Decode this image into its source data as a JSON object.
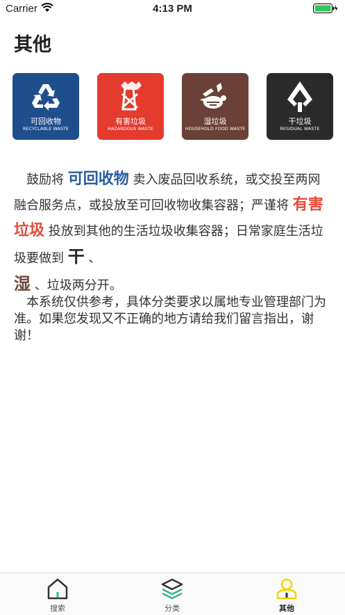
{
  "status_bar": {
    "carrier": "Carrier",
    "time": "4:13 PM"
  },
  "page": {
    "title": "其他"
  },
  "categories": [
    {
      "cn": "可回收物",
      "en": "RECYCLABLE WASTE",
      "color": "#1f4e8c",
      "icon": "recycle-icon"
    },
    {
      "cn": "有害垃圾",
      "en": "HAZARDOUS WASTE",
      "color": "#e53a2e",
      "icon": "hazardous-icon"
    },
    {
      "cn": "湿垃圾",
      "en": "HOUSEHOLD FOOD WASTE",
      "color": "#6b4036",
      "icon": "food-waste-icon"
    },
    {
      "cn": "干垃圾",
      "en": "RESIDUAL WASTE",
      "color": "#2b2b2b",
      "icon": "residual-waste-icon"
    }
  ],
  "description": {
    "p1": {
      "t1": "鼓励将",
      "recyclable": "可回收物",
      "t2": "卖入废品回收系统，或交投至两网融合服务点，或投放至可回收物收集容器；严谨将",
      "hazardous": "有害垃圾",
      "t3": "投放到其他的生活垃圾收集容器；日常家庭生活垃圾要做到",
      "dry": "干",
      "t4": "、",
      "wet": "湿",
      "t5": "、垃圾两分开。"
    },
    "p2": "本系统仅供参考，具体分类要求以属地专业管理部门为准。如果您发现又不正确的地方请给我们留言指出，谢谢！"
  },
  "tabs": [
    {
      "label": "搜索",
      "icon": "home-icon",
      "active": false
    },
    {
      "label": "分类",
      "icon": "layers-icon",
      "active": false
    },
    {
      "label": "其他",
      "icon": "user-icon",
      "active": true
    }
  ],
  "colors": {
    "accent_blue": "#2a5aa0",
    "accent_red": "#e34b3a",
    "accent_brown": "#6b4a3e",
    "tab_active": "#f5d400",
    "tab_green": "#2eb886",
    "battery_green": "#34c759"
  }
}
